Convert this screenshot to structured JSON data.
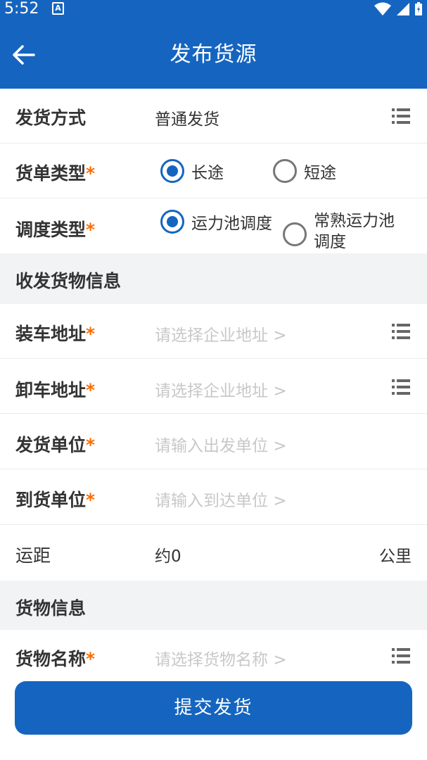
{
  "status": {
    "time": "5:52",
    "notif": "A"
  },
  "header": {
    "title": "发布货源"
  },
  "rows": {
    "ship_method": {
      "label": "发货方式",
      "value": "普通发货"
    },
    "order_type": {
      "label": "货单类型",
      "options": [
        "长途",
        "短途"
      ],
      "selected": "长途"
    },
    "dispatch_type": {
      "label": "调度类型",
      "options": [
        "运力池调度",
        "常熟运力池调度"
      ],
      "selected": "运力池调度"
    }
  },
  "sections": {
    "cargo_io": "收发货物信息",
    "cargo": "货物信息"
  },
  "fields": {
    "load_addr": {
      "label": "装车地址",
      "placeholder": "请选择企业地址"
    },
    "unload_addr": {
      "label": "卸车地址",
      "placeholder": "请选择企业地址"
    },
    "ship_unit": {
      "label": "发货单位",
      "placeholder": "请输入出发单位"
    },
    "arrive_unit": {
      "label": "到货单位",
      "placeholder": "请输入到达单位"
    },
    "distance": {
      "label": "运距",
      "value": "约0",
      "unit": "公里"
    },
    "cargo_name": {
      "label": "货物名称",
      "placeholder": "请选择货物名称"
    }
  },
  "req_mark": "*",
  "chevron": ">",
  "submit": {
    "label": "提交发货"
  },
  "colors": {
    "primary": "#1565c0",
    "required": "#ff6a00",
    "placeholder": "#c8c8c8"
  }
}
